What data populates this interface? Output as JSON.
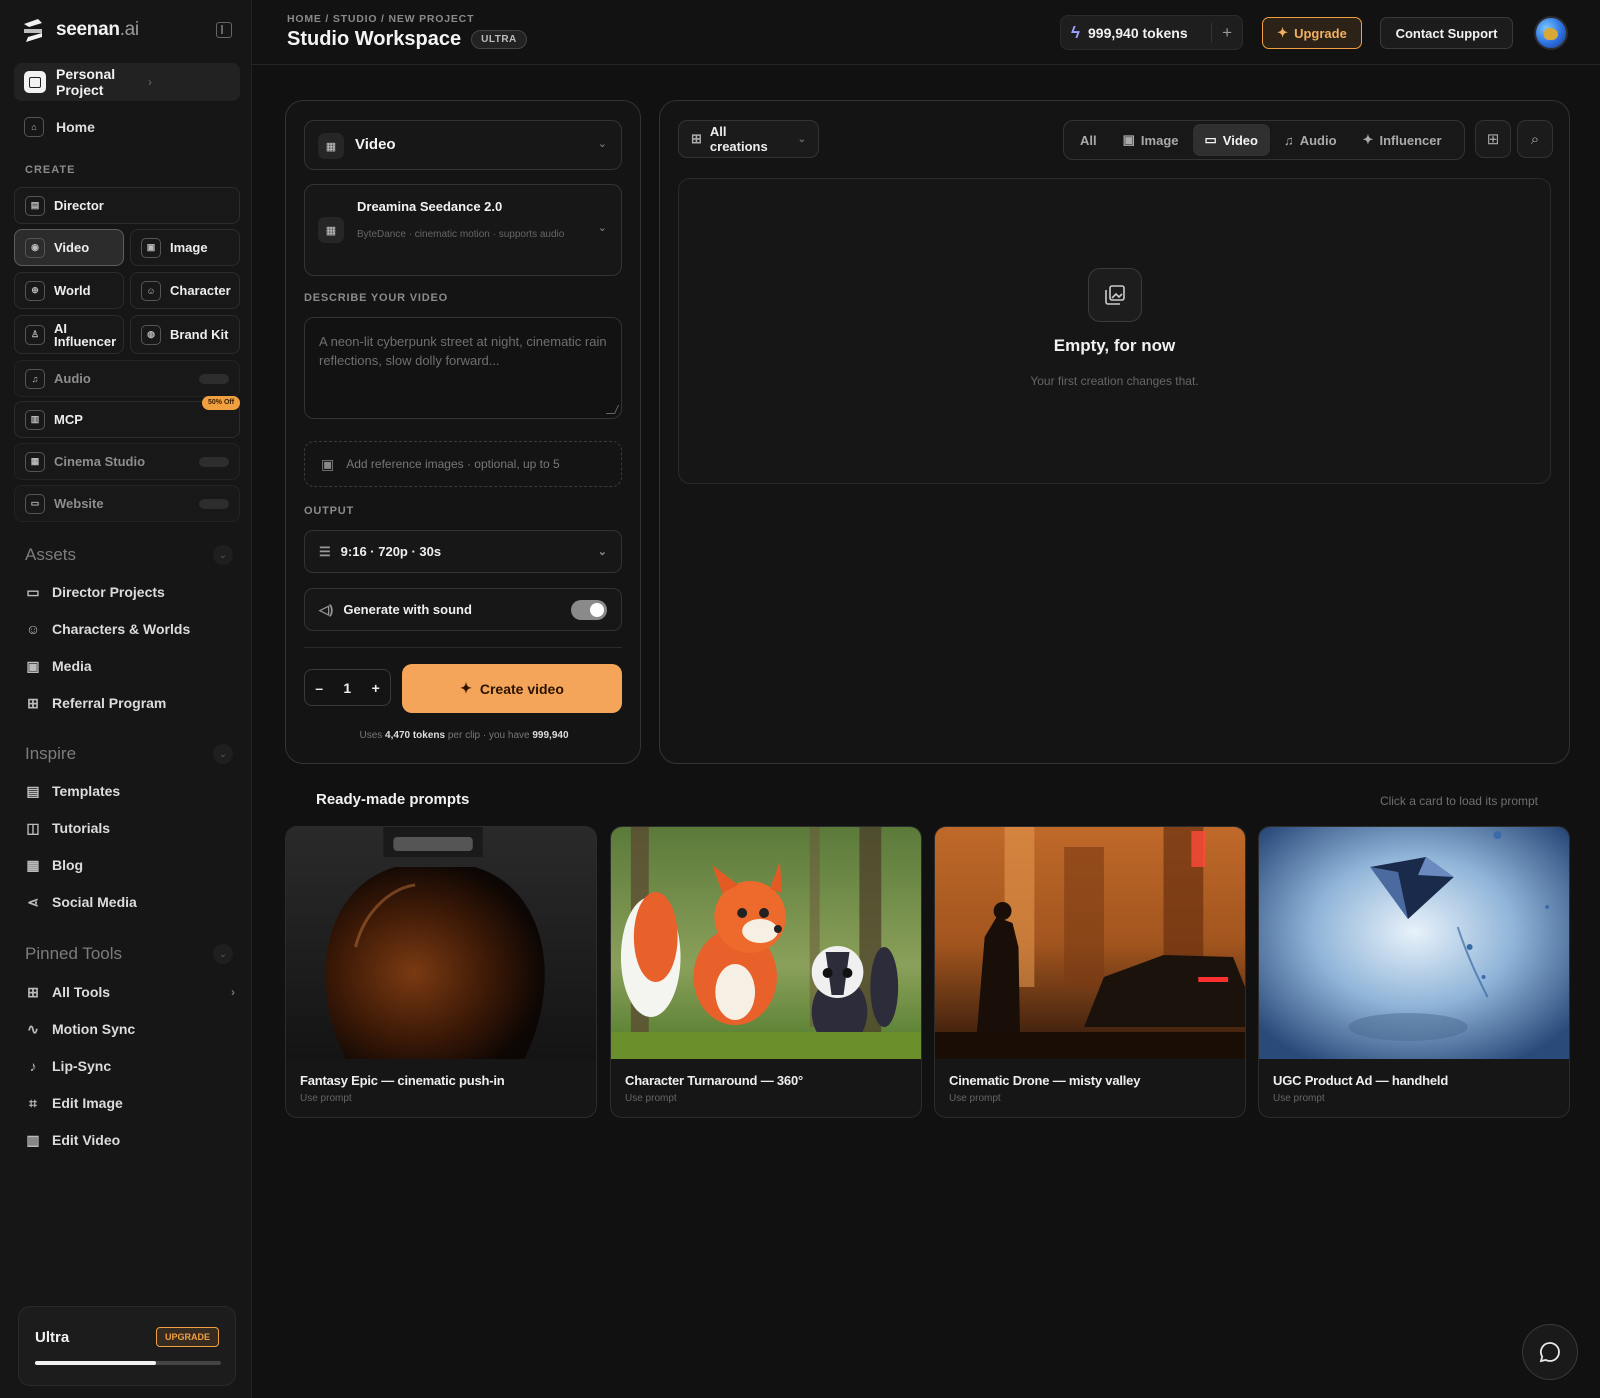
{
  "brand": {
    "name": "seenan",
    "suffix": ".ai"
  },
  "sidebar": {
    "project": "Personal Project",
    "home": "Home",
    "create_label": "CREATE",
    "tools": {
      "director": "Director",
      "video": "Video",
      "image": "Image",
      "world": "World",
      "character": "Character",
      "ai_influencer": "AI Influencer",
      "brand_kit": "Brand Kit",
      "audio": "Audio",
      "mcp": "MCP",
      "mcp_badge": "50% Off",
      "cinema_studio": "Cinema Studio",
      "website": "Website"
    },
    "assets": {
      "label": "Assets",
      "items": [
        "Director Projects",
        "Characters & Worlds",
        "Media",
        "Referral Program"
      ]
    },
    "inspire": {
      "label": "Inspire",
      "items": [
        "Templates",
        "Tutorials",
        "Blog",
        "Social Media"
      ]
    },
    "pinned": {
      "label": "Pinned Tools",
      "items": [
        "All Tools",
        "Motion Sync",
        "Lip-Sync",
        "Edit Image",
        "Edit Video"
      ]
    },
    "plan": {
      "name": "Ultra",
      "upgrade_label": "UPGRADE",
      "usage_fraction": 0.65
    }
  },
  "header": {
    "breadcrumb": "HOME / STUDIO / NEW PROJECT",
    "title": "Studio Workspace",
    "badge": "ULTRA",
    "tokens": "999,940 tokens",
    "upgrade": "Upgrade",
    "support": "Contact Support"
  },
  "composer": {
    "mode": "Video",
    "model": {
      "name": "Dreamina Seedance 2.0",
      "desc": "ByteDance · cinematic motion · supports audio"
    },
    "describe_label": "DESCRIBE YOUR VIDEO",
    "prompt_placeholder": "A neon-lit cyberpunk street at night, cinematic rain reflections, slow dolly forward...",
    "reference_label": "Add reference images · optional, up to 5",
    "output_label": "OUTPUT",
    "output_value": "9:16 · 720p · 30s",
    "sound_label": "Generate with sound",
    "sound_on": true,
    "quantity": "1",
    "create_label": "Create video",
    "uses_prefix": "Uses",
    "uses_tokens": "4,470 tokens",
    "uses_mid": "per clip · you have",
    "uses_balance": "999,940"
  },
  "gallery": {
    "dropdown": "All creations",
    "filters": [
      "All",
      "Image",
      "Video",
      "Audio",
      "Influencer"
    ],
    "active_filter": "Video",
    "empty_title": "Empty, for now",
    "empty_sub": "Your first creation changes that."
  },
  "prompts": {
    "title": "Ready-made prompts",
    "hint": "Click a card to load its prompt",
    "cards": [
      {
        "title": "Fantasy Epic — cinematic push-in",
        "sub": "Use prompt"
      },
      {
        "title": "Character Turnaround — 360°",
        "sub": "Use prompt"
      },
      {
        "title": "Cinematic Drone — misty valley",
        "sub": "Use prompt"
      },
      {
        "title": "UGC Product Ad — handheld",
        "sub": "Use prompt"
      }
    ]
  },
  "colors": {
    "accent": "#f5a55a",
    "background": "#111111",
    "panel": "#141414"
  }
}
